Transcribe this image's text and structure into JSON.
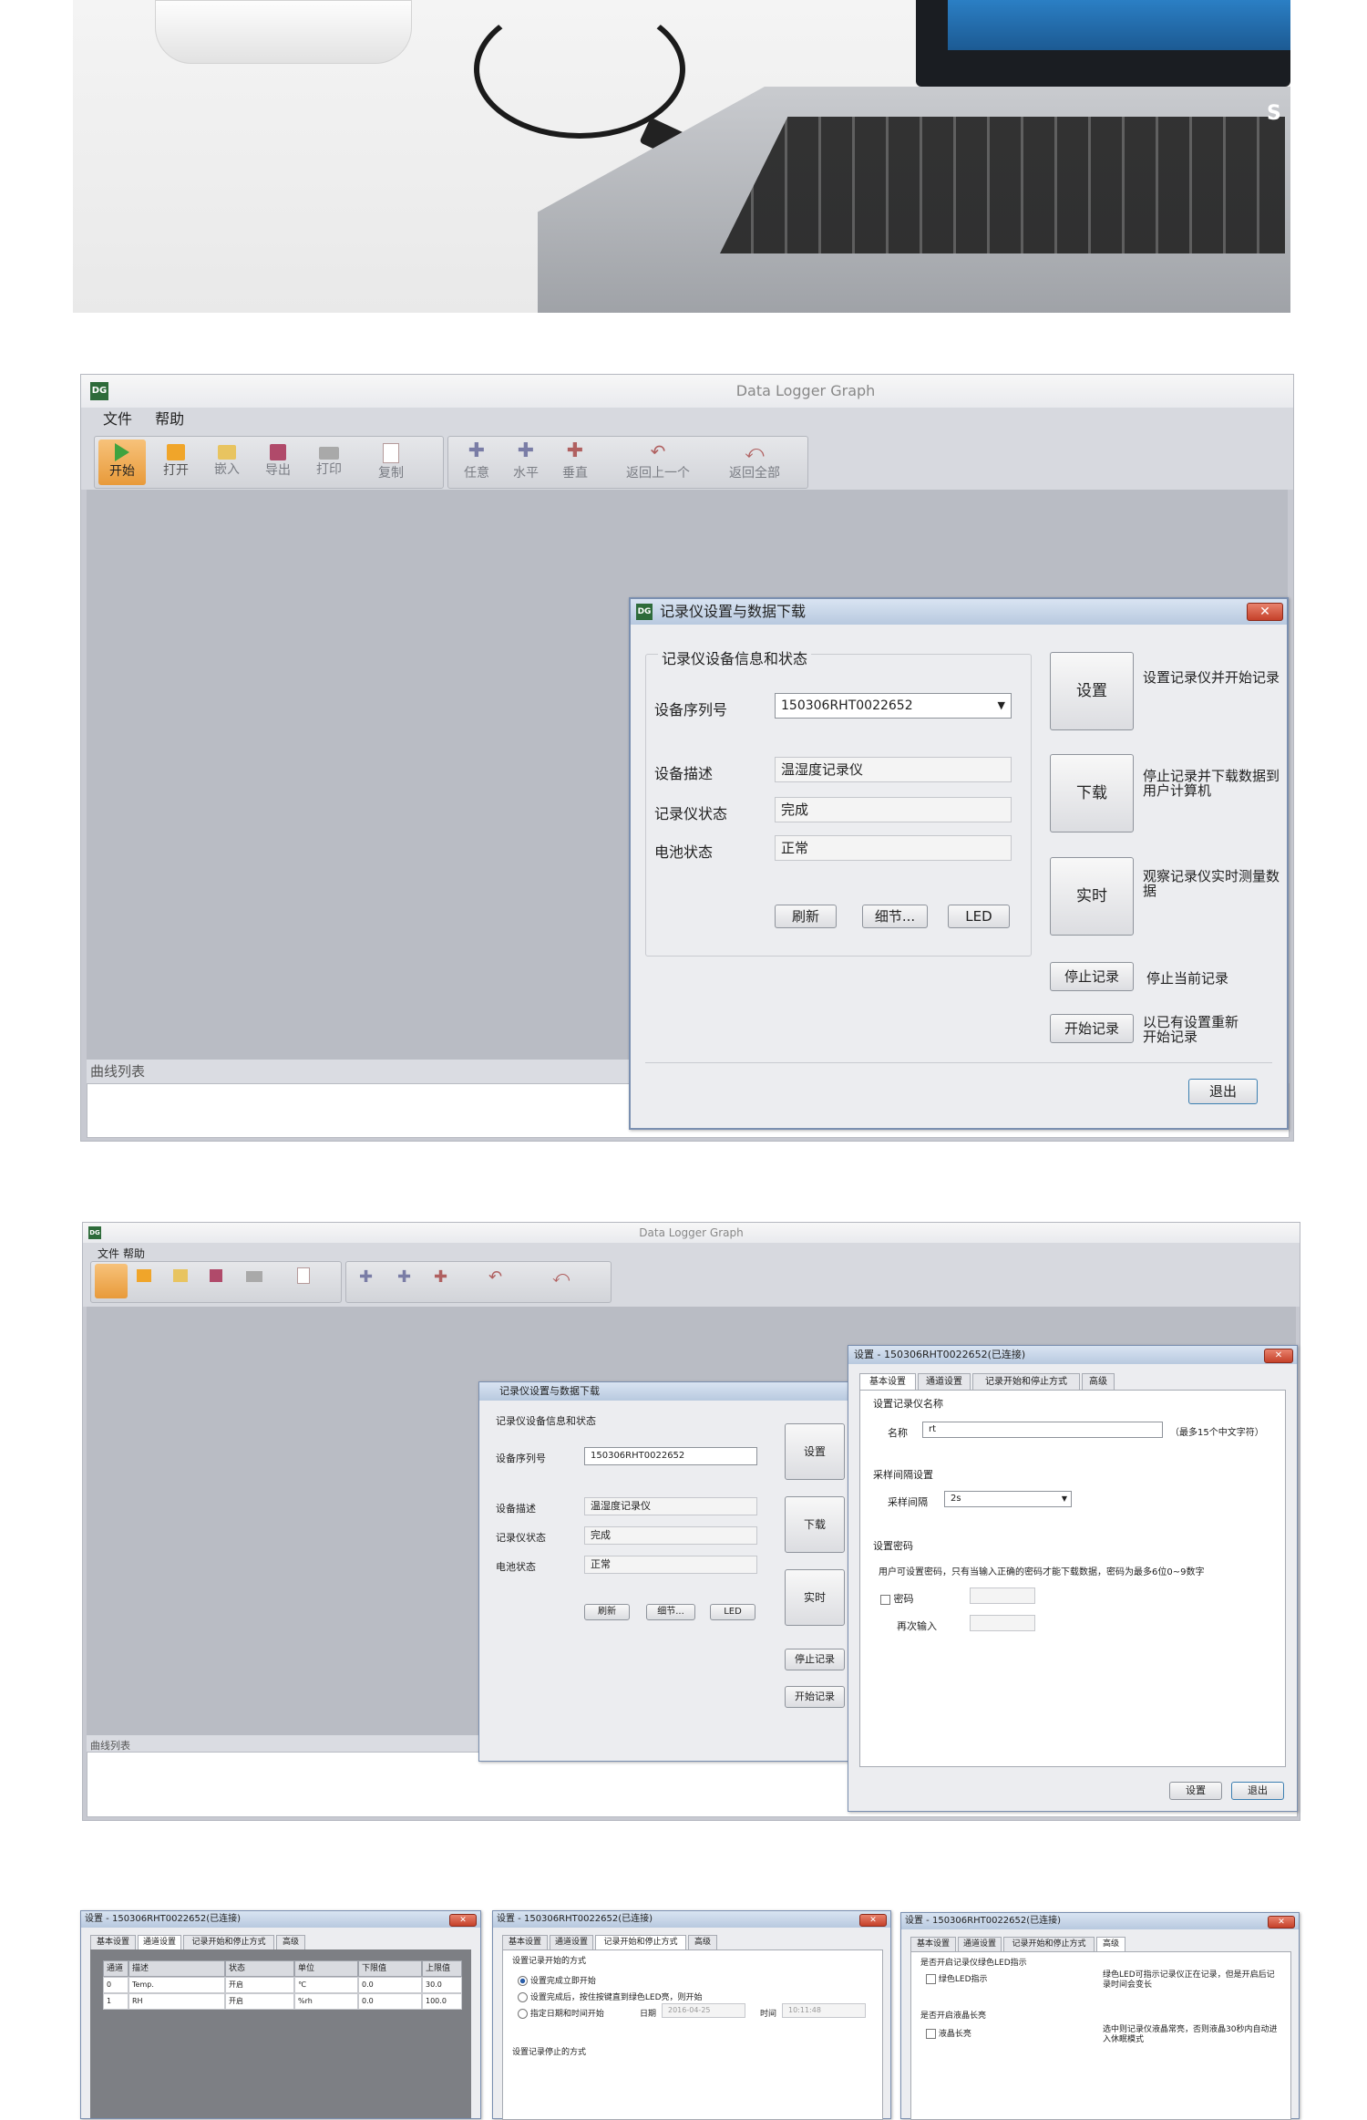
{
  "photo": {
    "brand_text": "S"
  },
  "window1": {
    "app_title": "Data Logger Graph",
    "menu": [
      "文件",
      "帮助"
    ],
    "toolbar": [
      {
        "icon": "play-icon",
        "label": "开始",
        "active": true
      },
      {
        "icon": "folder-open-icon",
        "label": "打开"
      },
      {
        "icon": "import-icon",
        "label": "嵌入"
      },
      {
        "icon": "save-icon",
        "label": "导出"
      },
      {
        "icon": "print-icon",
        "label": "打印"
      },
      {
        "icon": "copy-icon",
        "label": "复制"
      },
      {
        "icon": "move-any-icon",
        "label": "任意"
      },
      {
        "icon": "move-horizontal-icon",
        "label": "水平"
      },
      {
        "icon": "move-vertical-icon",
        "label": "垂直"
      },
      {
        "icon": "back-one-icon",
        "label": "返回上一个"
      },
      {
        "icon": "back-all-icon",
        "label": "返回全部"
      }
    ],
    "curve_list_label": "曲线列表",
    "dialog": {
      "title": "记录仪设置与数据下载",
      "group_title": "记录仪设备信息和状态",
      "serial_label": "设备序列号",
      "serial_value": "150306RHT0022652",
      "desc_label": "设备描述",
      "desc_value": "温湿度记录仪",
      "status_label": "记录仪状态",
      "status_value": "完成",
      "battery_label": "电池状态",
      "battery_value": "正常",
      "refresh_btn": "刷新",
      "details_btn": "细节...",
      "led_btn": "LED",
      "setup_btn": "设置",
      "setup_desc": "设置记录仪并开始记录",
      "download_btn": "下载",
      "download_desc": "停止记录并下载数据到用户计算机",
      "realtime_btn": "实时",
      "realtime_desc": "观察记录仪实时测量数据",
      "stop_btn": "停止记录",
      "stop_desc": "停止当前记录",
      "start_btn": "开始记录",
      "start_desc": "以已有设置重新开始记录",
      "exit_btn": "退出"
    }
  },
  "window2": {
    "app_title": "Data Logger Graph",
    "settings": {
      "title": "设置 - 150306RHT0022652(已连接)",
      "tabs": [
        "基本设置",
        "通道设置",
        "记录开始和停止方式",
        "高级"
      ],
      "name_group": "设置记录仪名称",
      "name_label": "名称",
      "name_value": "rt",
      "name_hint": "（最多15个中文字符）",
      "interval_group": "采样间隔设置",
      "interval_label": "采样间隔",
      "interval_value": "2s",
      "password_group": "设置密码",
      "password_hint": "用户可设置密码，只有当输入正确的密码才能下载数据，密码为最多6位0~9数字",
      "password_label": "密码",
      "reenter_label": "再次输入",
      "ok_btn": "设置",
      "cancel_btn": "退出"
    }
  },
  "panel_a": {
    "title": "设置 - 150306RHT0022652(已连接)",
    "tabs": [
      "基本设置",
      "通道设置",
      "记录开始和停止方式",
      "高级"
    ],
    "columns": [
      "通道",
      "描述",
      "状态",
      "单位",
      "下限值",
      "上限值"
    ],
    "rows": [
      [
        "0",
        "Temp.",
        "开启",
        "℃",
        "0.0",
        "30.0"
      ],
      [
        "1",
        "RH",
        "开启",
        "%rh",
        "0.0",
        "100.0"
      ]
    ]
  },
  "panel_b": {
    "title": "设置 - 150306RHT0022652(已连接)",
    "tabs": [
      "基本设置",
      "通道设置",
      "记录开始和停止方式",
      "高级"
    ],
    "start_group": "设置记录开始的方式",
    "opt1": "设置完成立即开始",
    "opt2": "设置完成后，按住按键直到绿色LED亮，则开始",
    "opt3": "指定日期和时间开始",
    "date_label": "日期",
    "date_value": "2016-04-25",
    "time_label": "时间",
    "time_value": "10:11:48",
    "stop_group": "设置记录停止的方式"
  },
  "panel_c": {
    "title": "设置 - 150306RHT0022652(已连接)",
    "tabs": [
      "基本设置",
      "通道设置",
      "记录开始和停止方式",
      "高级"
    ],
    "led_group": "是否开启记录仪绿色LED指示",
    "led_label": "绿色LED指示",
    "led_desc": "绿色LED可指示记录仪正在记录，但是开启后记录时间会变长",
    "lcd_group": "是否开启液晶长亮",
    "lcd_label": "液晶长亮",
    "lcd_desc": "选中则记录仪液晶常亮，否则液晶30秒内自动进入休眠模式"
  },
  "colors": {
    "accent_green": "#3fa33f",
    "close_red": "#c5412a",
    "workspace": "#b9bcc4"
  }
}
